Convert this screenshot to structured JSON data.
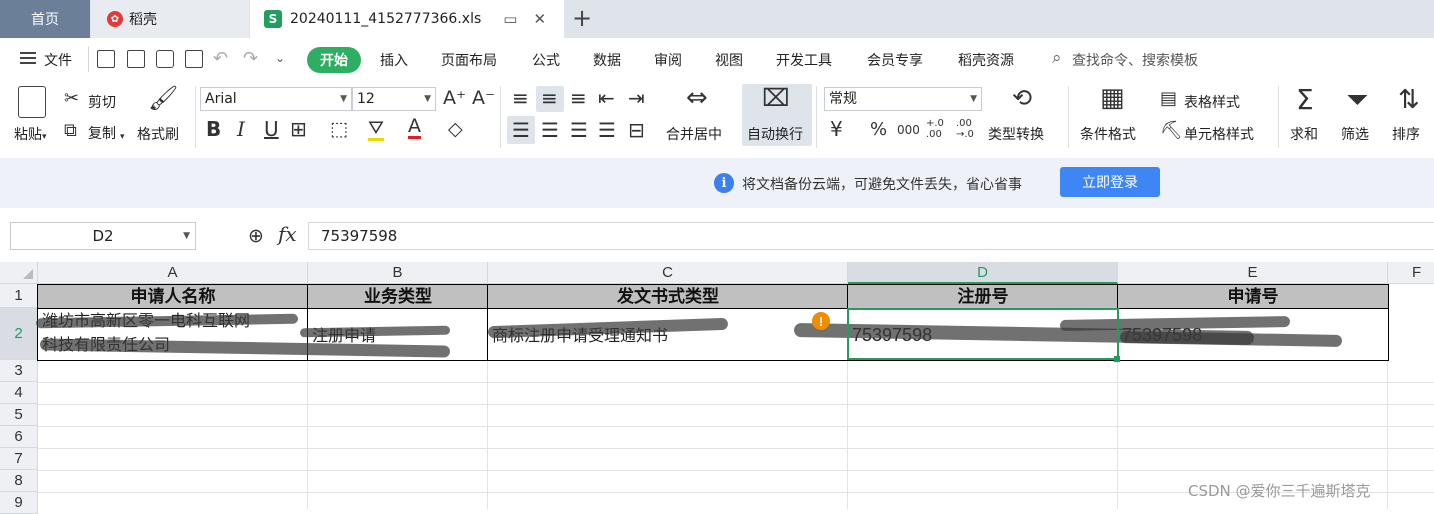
{
  "tabs": {
    "home": "首页",
    "docer": "稻壳",
    "file": "20240111_4152777366.xls",
    "add": "+"
  },
  "menu": {
    "file": "文件",
    "start": "开始",
    "insert": "插入",
    "page_layout": "页面布局",
    "formula": "公式",
    "data": "数据",
    "review": "审阅",
    "view": "视图",
    "dev_tools": "开发工具",
    "member": "会员专享",
    "docer_res": "稻壳资源",
    "search": "查找命令、搜索模板"
  },
  "ribbon": {
    "paste": "粘贴",
    "cut": "剪切",
    "copy": "复制",
    "format_painter": "格式刷",
    "font_name": "Arial",
    "font_size": "12",
    "merge_center": "合并居中",
    "wrap_text": "自动换行",
    "number_format": "常规",
    "type_convert": "类型转换",
    "cond_format": "条件格式",
    "table_style": "表格样式",
    "cell_style": "单元格样式",
    "sum": "求和",
    "filter": "筛选",
    "sort": "排序",
    "bold": "B",
    "italic": "I",
    "underline": "U",
    "currency": "¥",
    "percent": "%",
    "thousands": "000",
    "inc_decimal": "+.0 .00",
    "dec_decimal": ".00 →.0"
  },
  "notify": {
    "text": "将文档备份云端，可避免文件丢失，省心省事",
    "login": "立即登录",
    "info_icon": "i"
  },
  "formula_bar": {
    "cell_ref": "D2",
    "fx": "fx",
    "value": "75397598"
  },
  "grid": {
    "columns": [
      "A",
      "B",
      "C",
      "D",
      "E",
      "F"
    ],
    "rows": [
      "1",
      "2",
      "3",
      "4",
      "5",
      "6",
      "7",
      "8",
      "9"
    ],
    "selected_column": "D",
    "selected_row": "2",
    "header_row": [
      "申请人名称",
      "业务类型",
      "发文书式类型",
      "注册号",
      "申请号"
    ],
    "data_row": {
      "a_line1": "潍坊市高新区零一电科互联网",
      "a_line2": "科技有限责任公司",
      "b": "注册申请",
      "c": "商标注册申请受理通知书",
      "d": "75397598",
      "e": "75397598"
    },
    "warn_icon": "!"
  },
  "watermark": "CSDN @爱你三千遍斯塔克",
  "colors": {
    "accent": "#1f9e5e",
    "start_tab": "#2eae62",
    "login_button": "#3e86f5",
    "header_fill": "#c0c0c0"
  }
}
